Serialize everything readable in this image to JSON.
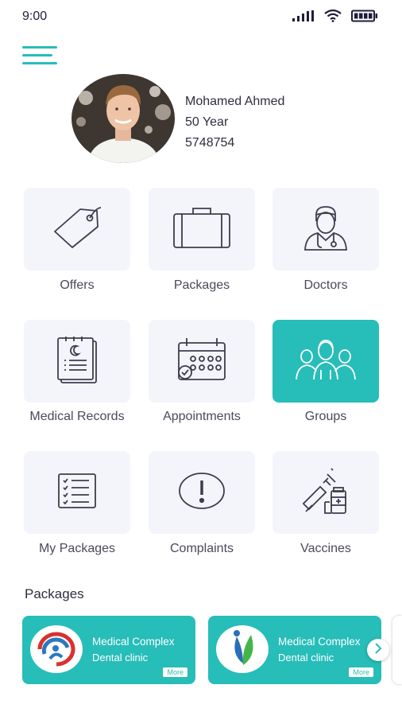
{
  "status_bar": {
    "time": "9:00"
  },
  "colors": {
    "accent": "#27bdb9",
    "tile_bg": "#f4f5fb",
    "text": "#2e2e40"
  },
  "profile": {
    "name": "Mohamed Ahmed",
    "age": "50 Year",
    "id": "5748754"
  },
  "menu": [
    {
      "label": "Offers",
      "icon": "tag-icon",
      "active": false
    },
    {
      "label": "Packages",
      "icon": "briefcase-icon",
      "active": false
    },
    {
      "label": "Doctors",
      "icon": "doctor-icon",
      "active": false
    },
    {
      "label": "Medical Records",
      "icon": "medical-records-icon",
      "active": false
    },
    {
      "label": "Appointments",
      "icon": "calendar-icon",
      "active": false
    },
    {
      "label": "Groups",
      "icon": "group-icon",
      "active": true
    },
    {
      "label": "My Packages",
      "icon": "checklist-icon",
      "active": false
    },
    {
      "label": "Complaints",
      "icon": "exclamation-icon",
      "active": false
    },
    {
      "label": "Vaccines",
      "icon": "syringe-icon",
      "active": false
    }
  ],
  "packages_section": {
    "title": "Packages",
    "cards": [
      {
        "name": "Medical Complex",
        "subtitle": "Dental clinic",
        "more_label": "More",
        "logo": "medical-complex-logo-red-blue"
      },
      {
        "name": "Medical Complex",
        "subtitle": "Dental clinic",
        "more_label": "More",
        "logo": "medical-complex-logo-green-blue"
      }
    ]
  }
}
